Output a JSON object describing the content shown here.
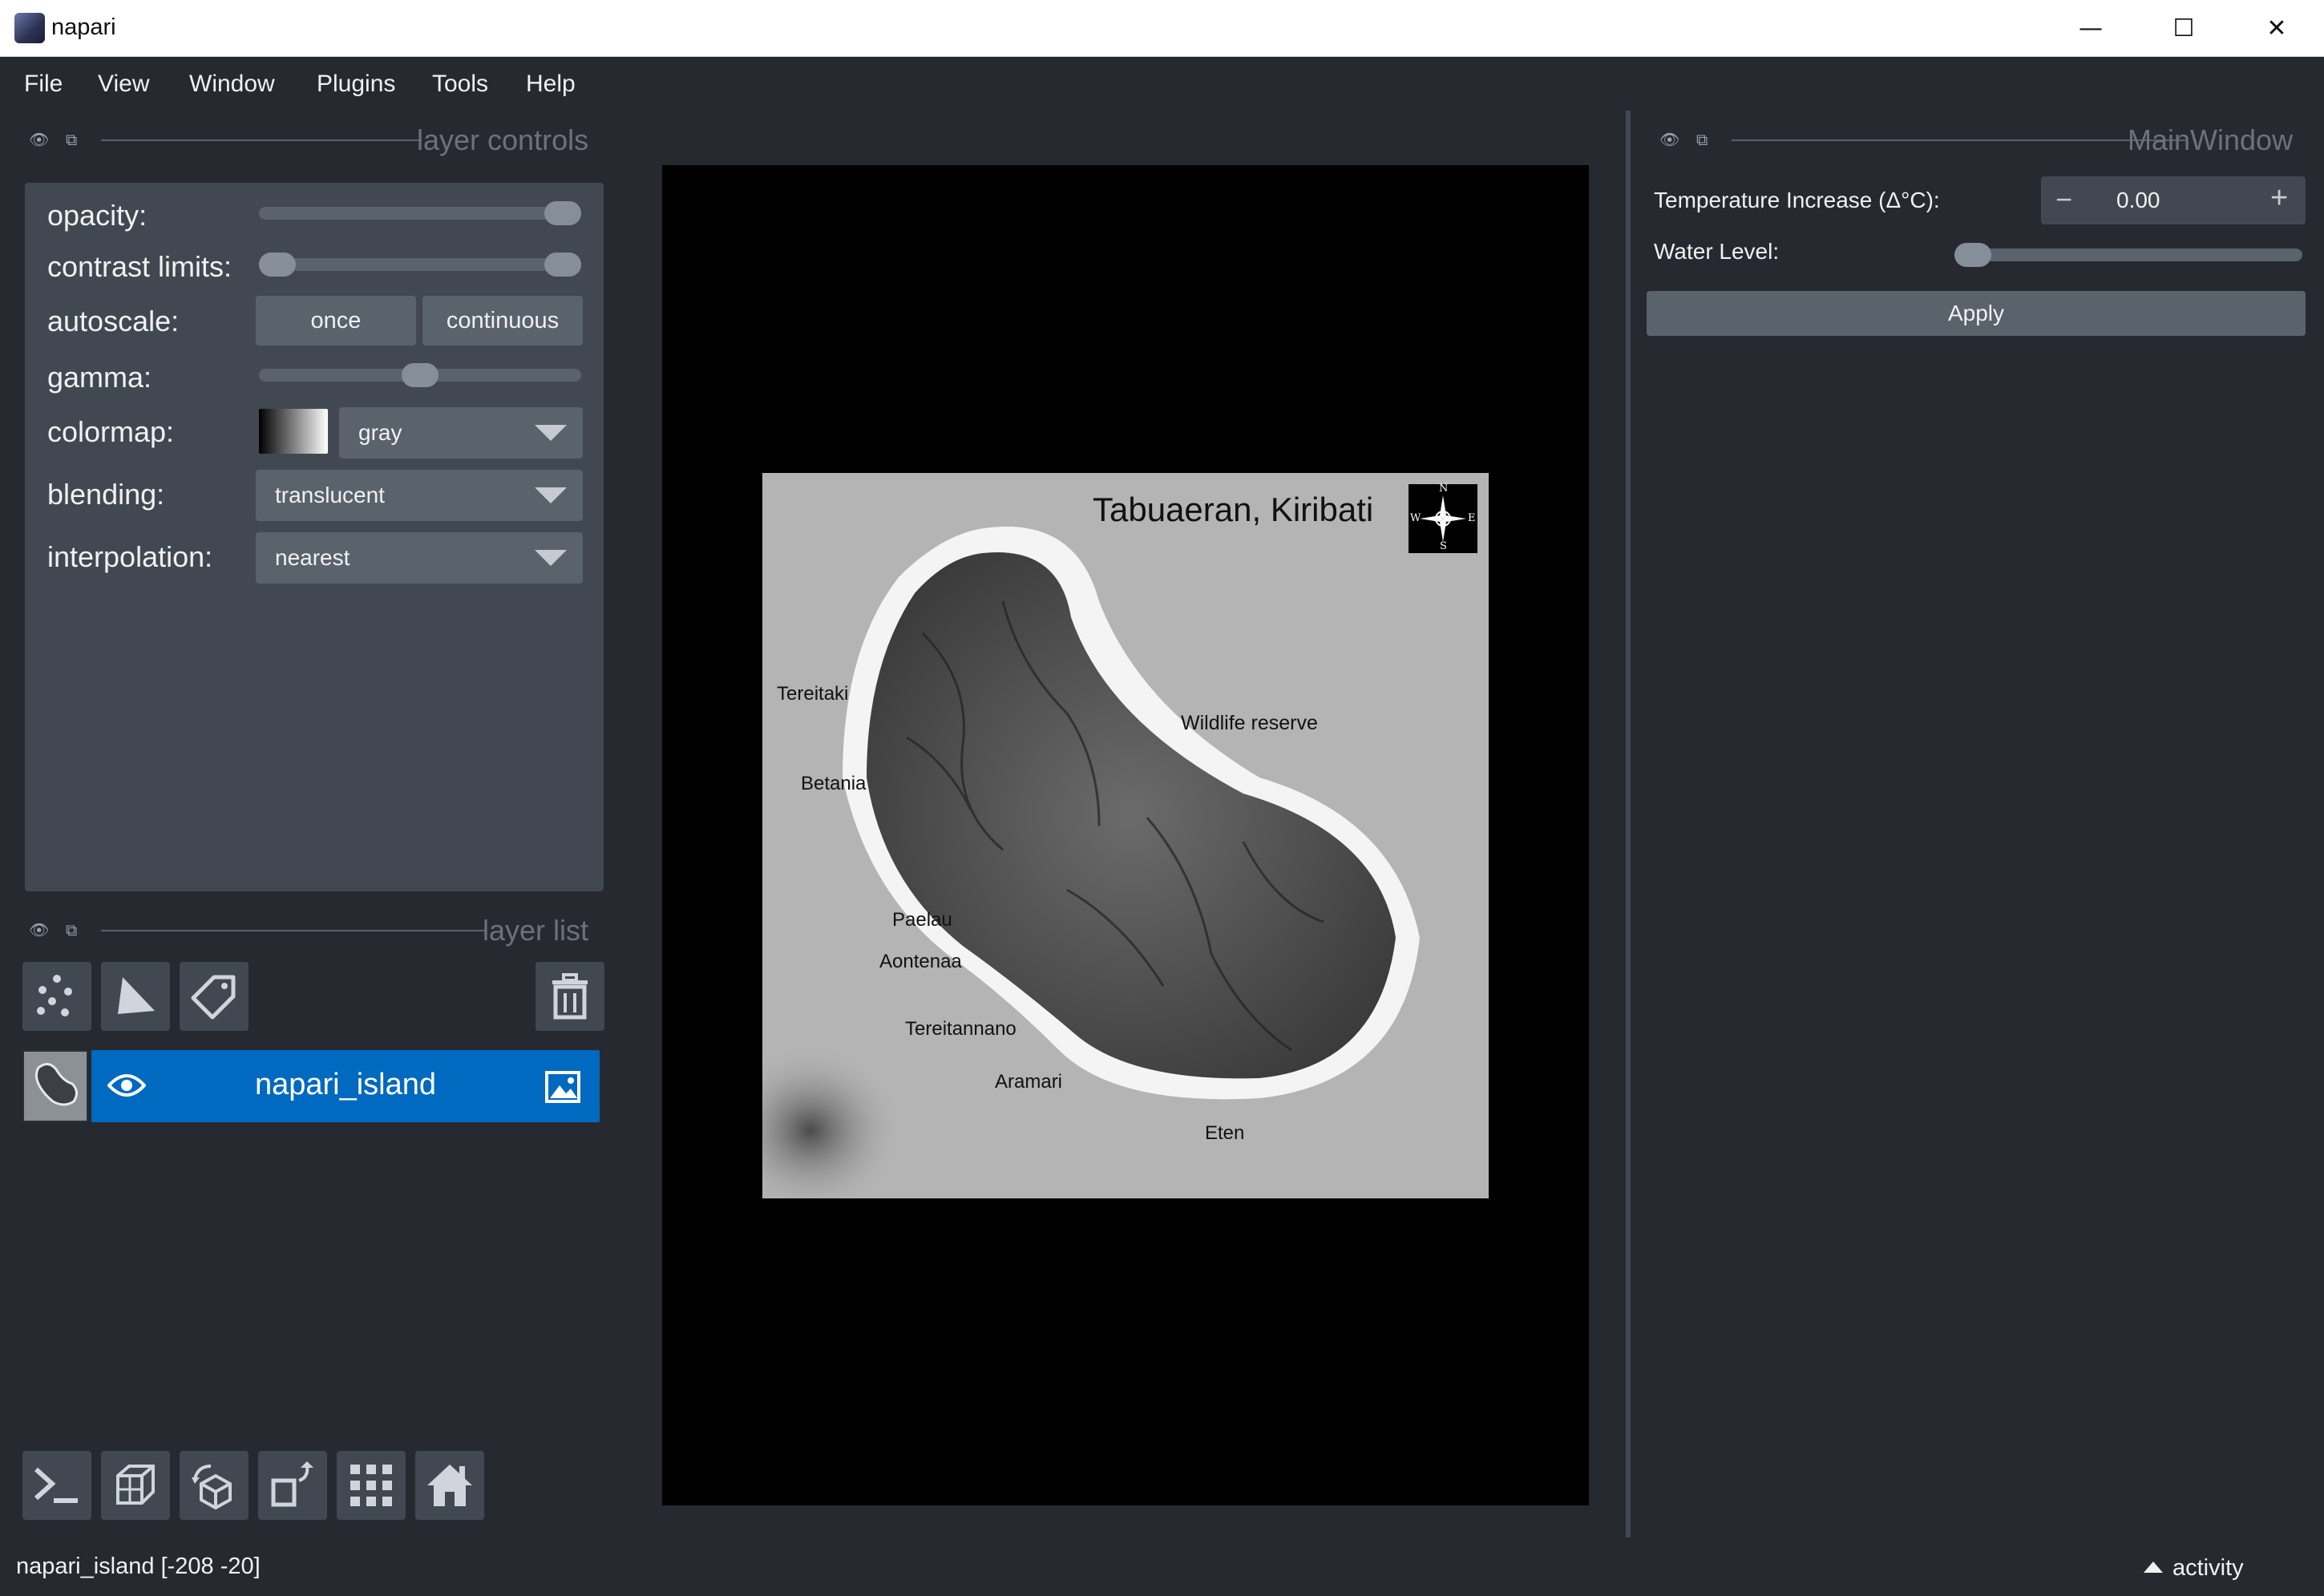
{
  "window": {
    "title": "napari",
    "minimize_glyph": "—",
    "maximize_glyph": "☐",
    "close_glyph": "✕"
  },
  "menu": [
    "File",
    "View",
    "Window",
    "Plugins",
    "Tools",
    "Help"
  ],
  "layer_controls": {
    "header": "layer controls",
    "opacity_label": "opacity:",
    "contrast_label": "contrast limits:",
    "autoscale_label": "autoscale:",
    "autoscale_once": "once",
    "autoscale_continuous": "continuous",
    "gamma_label": "gamma:",
    "colormap_label": "colormap:",
    "colormap_value": "gray",
    "blending_label": "blending:",
    "blending_value": "translucent",
    "interpolation_label": "interpolation:",
    "interpolation_value": "nearest",
    "opacity_level": 1.0,
    "contrast_low_level": 0.0,
    "contrast_high_level": 1.0,
    "gamma_level": 0.5
  },
  "layer_list": {
    "header": "layer list",
    "layers": [
      {
        "name": "napari_island",
        "visible": true,
        "type_icon": "image-icon"
      }
    ]
  },
  "canvas": {
    "map_title": "Tabuaeran, Kiribati",
    "compass": {
      "n": "N",
      "s": "S",
      "e": "E",
      "w": "W"
    },
    "place_labels": [
      "Tereitaki",
      "Wildlife reserve",
      "Betania",
      "Paelau",
      "Aontenaa",
      "Tereitannano",
      "Aramari",
      "Eten"
    ]
  },
  "main_window": {
    "header": "MainWindow",
    "temperature_label": "Temperature Increase (Δ°C):",
    "temperature_value": "0.00",
    "minus": "−",
    "plus": "+",
    "water_level_label": "Water Level:",
    "water_level": 0.0,
    "apply_label": "Apply"
  },
  "status": {
    "text": "napari_island [-208  -20]",
    "activity_label": "activity"
  }
}
